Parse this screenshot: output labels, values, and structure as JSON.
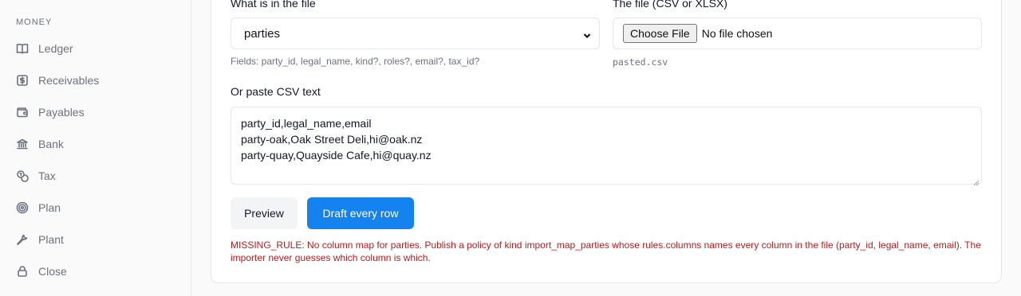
{
  "sidebar": {
    "section": "MONEY",
    "items": [
      {
        "label": "Ledger",
        "icon": "book-icon"
      },
      {
        "label": "Receivables",
        "icon": "dollar-icon"
      },
      {
        "label": "Payables",
        "icon": "wallet-icon"
      },
      {
        "label": "Bank",
        "icon": "bank-icon"
      },
      {
        "label": "Tax",
        "icon": "coins-icon"
      },
      {
        "label": "Plan",
        "icon": "target-icon"
      },
      {
        "label": "Plant",
        "icon": "wrench-icon"
      },
      {
        "label": "Close",
        "icon": "lock-icon"
      }
    ]
  },
  "form": {
    "kind_label": "What is in the file",
    "kind_value": "parties",
    "kind_hint": "Fields: party_id, legal_name, kind?, roles?, email?, tax_id?",
    "file_label": "The file (CSV or XLSX)",
    "file_button": "Choose File",
    "file_status": "No file chosen",
    "file_name": "pasted.csv",
    "paste_label": "Or paste CSV text",
    "paste_lines": [
      "party_id,legal_name,email",
      "party-oak,Oak Street Deli,hi@oak.nz",
      "party-quay,Quayside Cafe,hi@quay.nz"
    ],
    "preview_label": "Preview",
    "draft_label": "Draft every row",
    "error_message": "MISSING_RULE: No column map for parties. Publish a policy of kind import_map_parties whose rules.columns names every column in the file (party_id, legal_name, email). The importer never guesses which column is which."
  },
  "colors": {
    "accent": "#1483f0",
    "error": "#b91c1c",
    "muted": "#6b7280"
  }
}
